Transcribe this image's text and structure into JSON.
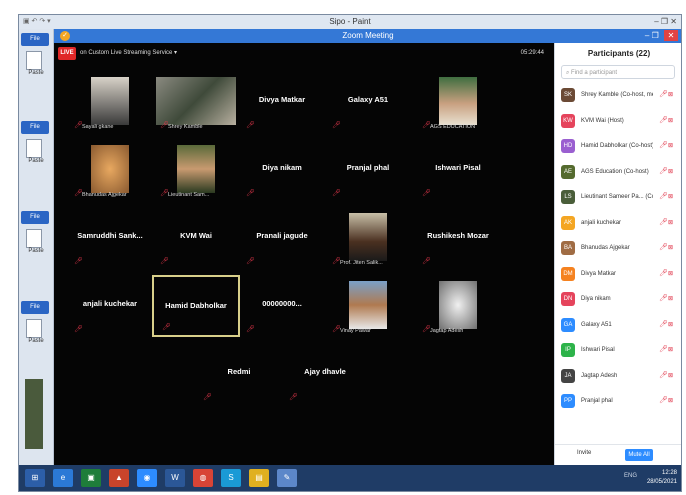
{
  "paint": {
    "title": "Sipo - Paint",
    "file_label": "File",
    "paste_label": "Paste",
    "window_controls": "–  ❐  ✕",
    "side_items": [
      "File",
      "Paste",
      "File",
      "Paste",
      "File",
      "Paste",
      "File",
      "Paste"
    ]
  },
  "zoom": {
    "title": "Zoom Meeting",
    "window_controls": [
      "–",
      "❐"
    ],
    "close": "✕",
    "live": "LIVE",
    "streaming": "on Custom Live Streaming Service ▾",
    "timer": "05:29:44"
  },
  "tiles": [
    {
      "name": "",
      "sub": "Sayali gkane"
    },
    {
      "name": "",
      "sub": "Shrey Kamble"
    },
    {
      "name": "Divya Matkar",
      "sub": ""
    },
    {
      "name": "Galaxy A51",
      "sub": ""
    },
    {
      "name": "",
      "sub": "AGS EDUCATION"
    },
    {
      "name": "",
      "sub": "Bhanudas Ajgekar"
    },
    {
      "name": "",
      "sub": "Lieutinant Sam..."
    },
    {
      "name": "Diya nikam",
      "sub": ""
    },
    {
      "name": "Pranjal phal",
      "sub": ""
    },
    {
      "name": "Ishwari Pisal",
      "sub": ""
    },
    {
      "name": "Samruddhi Sank...",
      "sub": ""
    },
    {
      "name": "KVM Wai",
      "sub": ""
    },
    {
      "name": "Pranali jagude",
      "sub": ""
    },
    {
      "name": "",
      "sub": "Prof. Jiten Salik..."
    },
    {
      "name": "Rushikesh Mozar",
      "sub": ""
    },
    {
      "name": "anjali kuchekar",
      "sub": ""
    },
    {
      "name": "Hamid Dabholkar",
      "sub": ""
    },
    {
      "name": "00000000...",
      "sub": ""
    },
    {
      "name": "",
      "sub": "Vinay Pawar"
    },
    {
      "name": "",
      "sub": "Jagtap Adesh"
    },
    {
      "name": "Redmi",
      "sub": ""
    },
    {
      "name": "Ajay dhavle",
      "sub": ""
    }
  ],
  "participants": {
    "title": "Participants (22)",
    "search_placeholder": "Find a participant",
    "list": [
      {
        "name": "Shrey Kamble (Co-host, me)",
        "initials": "SK",
        "color": "#6b4a35"
      },
      {
        "name": "KVM Wai (Host)",
        "initials": "KW",
        "color": "#e5445c"
      },
      {
        "name": "Hamid Dabholkar (Co-host)",
        "initials": "HD",
        "color": "#9a5fd0"
      },
      {
        "name": "AGS Education (Co-host)",
        "initials": "AE",
        "color": "#556b2f"
      },
      {
        "name": "Lieutinant Sameer Pa... (Co-host)",
        "initials": "LS",
        "color": "#4a5e3a"
      },
      {
        "name": "anjali kuchekar",
        "initials": "AK",
        "color": "#f4a623"
      },
      {
        "name": "Bhanudas Ajgekar",
        "initials": "BA",
        "color": "#a06c44"
      },
      {
        "name": "Divya Matkar",
        "initials": "DM",
        "color": "#f58220"
      },
      {
        "name": "Diya nikam",
        "initials": "DN",
        "color": "#e5445c"
      },
      {
        "name": "Galaxy A51",
        "initials": "GA",
        "color": "#2d8cff"
      },
      {
        "name": "Ishwari Pisal",
        "initials": "IP",
        "color": "#2db34a"
      },
      {
        "name": "Jagtap Adesh",
        "initials": "JA",
        "color": "#444444"
      },
      {
        "name": "Pranjal phal",
        "initials": "PP",
        "color": "#2d8cff"
      }
    ],
    "invite": "Invite",
    "mute_all": "Mute All"
  },
  "taskbar": {
    "icons": [
      {
        "label": "e",
        "color": "#2b79d6"
      },
      {
        "label": "▣",
        "color": "#1e7d3a"
      },
      {
        "label": "▲",
        "color": "#c8442b"
      },
      {
        "label": "◉",
        "color": "#2d8cff"
      },
      {
        "label": "W",
        "color": "#2b5797"
      },
      {
        "label": "◍",
        "color": "#d84436"
      },
      {
        "label": "S",
        "color": "#1a9ad6"
      },
      {
        "label": "▤",
        "color": "#e0b020"
      },
      {
        "label": "✎",
        "color": "#5c87c9"
      }
    ],
    "clock_time": "12:28",
    "clock_date": "28/05/2021",
    "lang": "ENG"
  }
}
